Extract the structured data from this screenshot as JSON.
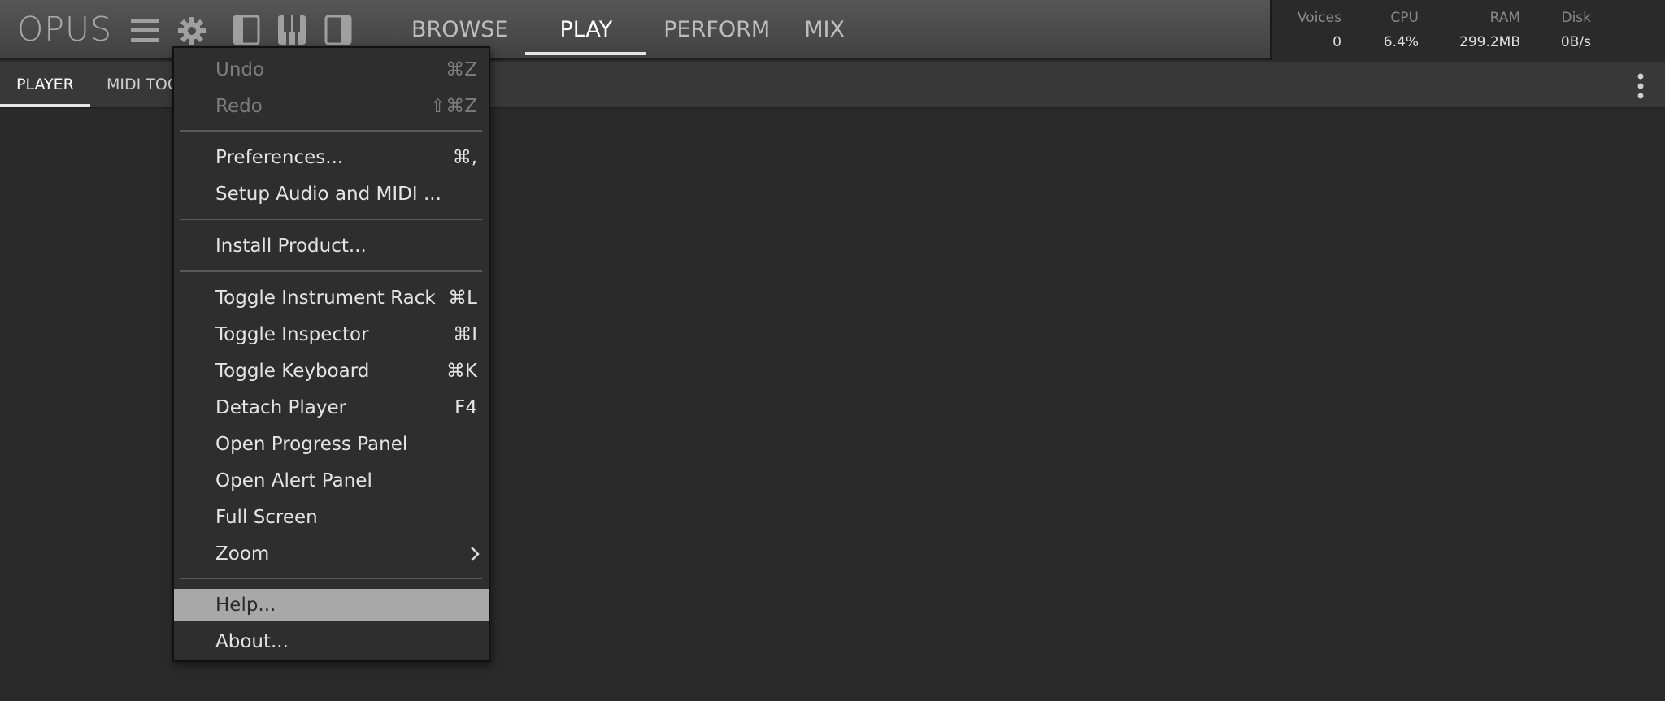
{
  "app": {
    "logo": "OPUS"
  },
  "main_tabs": [
    {
      "label": "BROWSE"
    },
    {
      "label": "PLAY",
      "active": true
    },
    {
      "label": "PERFORM"
    },
    {
      "label": "MIX"
    }
  ],
  "stats": {
    "voices": {
      "label": "Voices",
      "value": "0"
    },
    "cpu": {
      "label": "CPU",
      "value": "6.4%"
    },
    "ram": {
      "label": "RAM",
      "value": "299.2MB"
    },
    "disk": {
      "label": "Disk",
      "value": "0B/s"
    }
  },
  "sub_tabs": [
    {
      "label": "PLAYER",
      "active": true
    },
    {
      "label": "MIDI TOO"
    }
  ],
  "menu": {
    "items": [
      {
        "label": "Undo",
        "shortcut": "⌘Z",
        "disabled": true
      },
      {
        "label": "Redo",
        "shortcut": "⇧⌘Z",
        "disabled": true
      },
      {
        "label": "Preferences...",
        "shortcut": "⌘,"
      },
      {
        "label": "Setup Audio and MIDI ...",
        "shortcut": ""
      },
      {
        "label": "Install Product...",
        "shortcut": ""
      },
      {
        "label": "Toggle Instrument Rack",
        "shortcut": "⌘L"
      },
      {
        "label": "Toggle Inspector",
        "shortcut": "⌘I"
      },
      {
        "label": "Toggle Keyboard",
        "shortcut": "⌘K"
      },
      {
        "label": "Detach Player",
        "shortcut": "F4"
      },
      {
        "label": "Open Progress Panel",
        "shortcut": ""
      },
      {
        "label": "Open Alert Panel",
        "shortcut": ""
      },
      {
        "label": "Full Screen",
        "shortcut": ""
      },
      {
        "label": "Zoom",
        "shortcut": "",
        "submenu": true
      },
      {
        "label": "Help...",
        "shortcut": "",
        "highlighted": true
      },
      {
        "label": "About...",
        "shortcut": ""
      }
    ]
  },
  "icons": {
    "menu": "hamburger-icon",
    "settings": "gear-icon",
    "view_left": "panel-left-icon",
    "view_keys": "keyboard-icon",
    "view_right": "panel-right-icon",
    "more": "kebab-icon",
    "submenu": "chevron-right-icon"
  },
  "colors": {
    "background": "#2a2a2a",
    "topbar": "#4b4b4b",
    "menu_bg": "#2e2e2e",
    "menu_highlight": "#a8a8a8",
    "active_tab_underline": "#e6e6e6"
  }
}
